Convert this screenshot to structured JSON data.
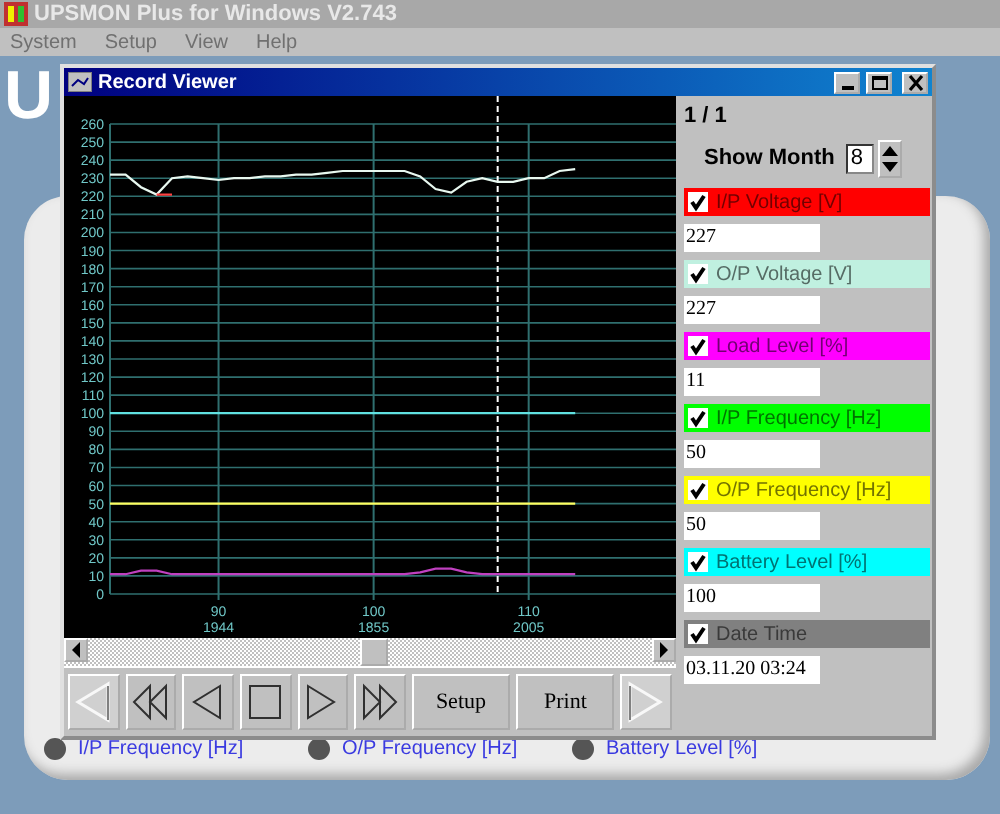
{
  "app": {
    "title": "UPSMON Plus for Windows V2.743",
    "menu": [
      "System",
      "Setup",
      "View",
      "Help"
    ],
    "logo_text": "U",
    "indicators": [
      {
        "label": "I/P Frequency [Hz]"
      },
      {
        "label": "O/P Frequency [Hz]"
      },
      {
        "label": "Battery Level [%]"
      }
    ]
  },
  "record_viewer": {
    "title": "Record Viewer",
    "chart_data": {
      "type": "line",
      "categories": [
        null,
        null,
        null,
        null,
        null,
        null,
        null,
        "90\n1944",
        null,
        null,
        null,
        null,
        null,
        null,
        null,
        null,
        null,
        "100\n1855",
        null,
        null,
        null,
        null,
        null,
        null,
        null,
        null,
        null,
        "110\n2005",
        null,
        null,
        null
      ],
      "ylim": [
        0,
        260
      ],
      "yticks": [
        0,
        10,
        20,
        30,
        40,
        50,
        60,
        70,
        80,
        90,
        100,
        110,
        120,
        130,
        140,
        150,
        160,
        170,
        180,
        190,
        200,
        210,
        220,
        230,
        240,
        250,
        260
      ],
      "series": [
        {
          "color": "#e8f8f0",
          "values": [
            232,
            232,
            225,
            221,
            230,
            231,
            230,
            229,
            230,
            230,
            231,
            231,
            232,
            232,
            233,
            234,
            234,
            234,
            234,
            234,
            231,
            224,
            222,
            228,
            230,
            228,
            228,
            230,
            230,
            234,
            235
          ]
        },
        {
          "color": "#ff4040",
          "values": [
            null,
            null,
            null,
            221,
            221,
            null,
            null,
            null,
            null,
            null,
            null,
            null,
            null,
            null,
            null,
            null,
            null,
            null,
            null,
            null,
            null,
            null,
            null,
            null,
            null,
            null,
            null,
            null,
            null,
            null,
            null
          ]
        },
        {
          "color": "#60e0e0",
          "values": [
            100,
            100,
            100,
            100,
            100,
            100,
            100,
            100,
            100,
            100,
            100,
            100,
            100,
            100,
            100,
            100,
            100,
            100,
            100,
            100,
            100,
            100,
            100,
            100,
            100,
            100,
            100,
            100,
            100,
            100,
            100
          ]
        },
        {
          "color": "#ffff60",
          "values": [
            50,
            50,
            50,
            50,
            50,
            50,
            50,
            50,
            50,
            50,
            50,
            50,
            50,
            50,
            50,
            50,
            50,
            50,
            50,
            50,
            50,
            50,
            50,
            50,
            50,
            50,
            50,
            50,
            50,
            50,
            50
          ]
        },
        {
          "color": "#c040c0",
          "values": [
            11,
            11,
            13,
            13,
            11,
            11,
            11,
            11,
            11,
            11,
            11,
            11,
            11,
            11,
            11,
            11,
            11,
            11,
            11,
            11,
            12,
            14,
            14,
            12,
            11,
            11,
            11,
            11,
            11,
            11,
            11
          ]
        }
      ],
      "grid": true
    },
    "toolbar": [
      {
        "kind": "first",
        "disabled": true
      },
      {
        "kind": "rewind",
        "disabled": false
      },
      {
        "kind": "prev",
        "disabled": false
      },
      {
        "kind": "stop",
        "disabled": false
      },
      {
        "kind": "next",
        "disabled": false
      },
      {
        "kind": "fast-forward",
        "disabled": false
      },
      {
        "kind": "text",
        "label": "Setup",
        "disabled": false
      },
      {
        "kind": "text",
        "label": "Print",
        "disabled": false
      },
      {
        "kind": "last",
        "disabled": true
      }
    ],
    "panel": {
      "page": "1 / 1",
      "show_month_label": "Show Month",
      "show_month_value": "8",
      "parameters": [
        {
          "label": "I/P Voltage [V]",
          "color": "#ff0000",
          "checked": true,
          "value": "227"
        },
        {
          "label": "O/P Voltage [V]",
          "color": "#c0f0e0",
          "checked": true,
          "value": "227"
        },
        {
          "label": "Load Level [%]",
          "color": "#ff00ff",
          "checked": true,
          "value": "11"
        },
        {
          "label": "I/P Frequency [Hz]",
          "color": "#00ff00",
          "checked": true,
          "value": "50"
        },
        {
          "label": "O/P Frequency [Hz]",
          "color": "#ffff00",
          "checked": true,
          "value": "50"
        },
        {
          "label": "Battery Level [%]",
          "color": "#00ffff",
          "checked": true,
          "value": "100"
        },
        {
          "label": "Date Time",
          "color": "#808080",
          "checked": true,
          "value": "03.11.20 03:24"
        }
      ]
    }
  }
}
